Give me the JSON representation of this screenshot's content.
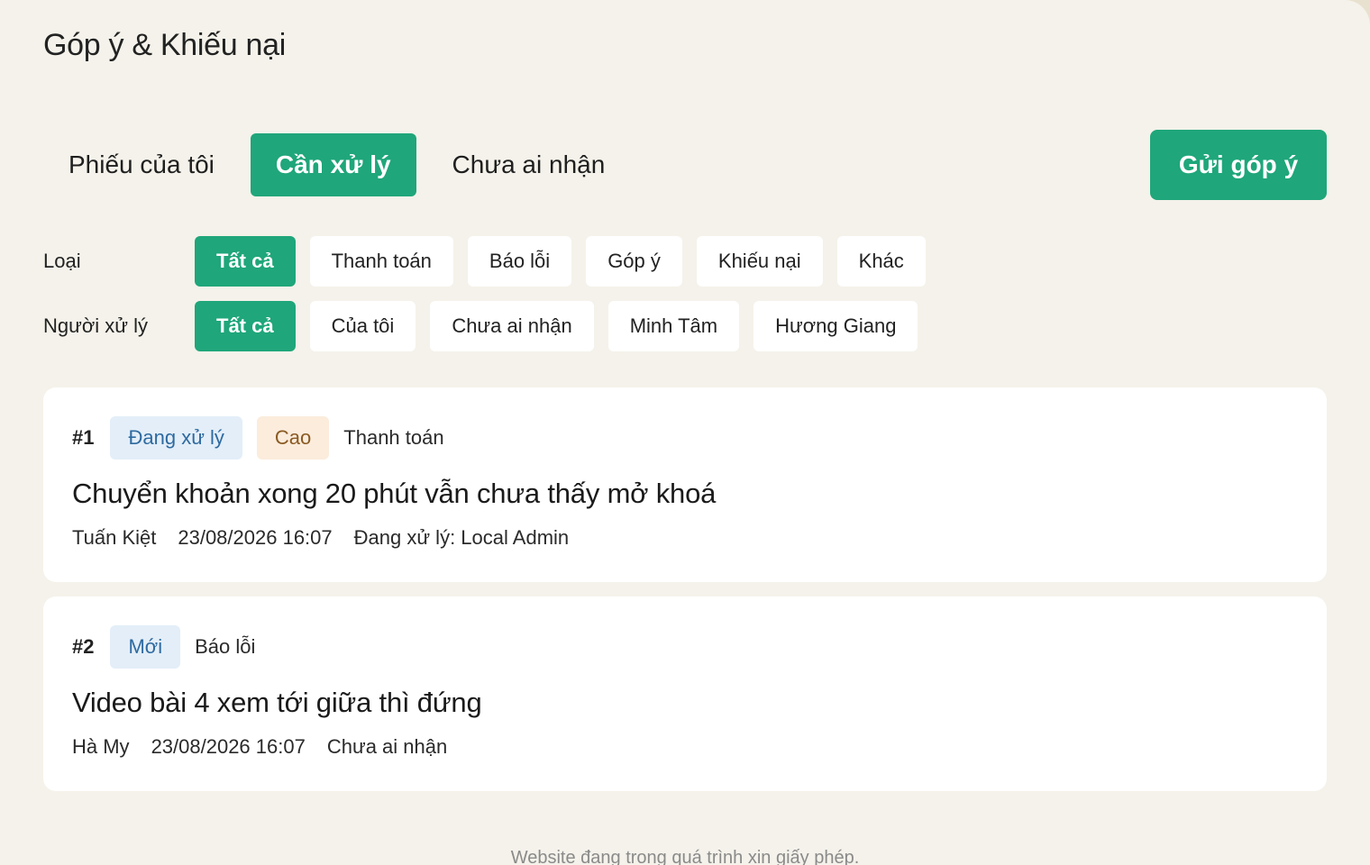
{
  "page": {
    "title": "Góp ý & Khiếu nại",
    "footer_note": "Website đang trong quá trình xin giấy phép."
  },
  "main_tabs": [
    {
      "label": "Phiếu của tôi",
      "active": false
    },
    {
      "label": "Cần xử lý",
      "active": true
    },
    {
      "label": "Chưa ai nhận",
      "active": false
    }
  ],
  "actions": {
    "submit_label": "Gửi góp ý"
  },
  "filters": {
    "type": {
      "label": "Loại",
      "options": [
        {
          "label": "Tất cả",
          "active": true
        },
        {
          "label": "Thanh toán",
          "active": false
        },
        {
          "label": "Báo lỗi",
          "active": false
        },
        {
          "label": "Góp ý",
          "active": false
        },
        {
          "label": "Khiếu nại",
          "active": false
        },
        {
          "label": "Khác",
          "active": false
        }
      ]
    },
    "handler": {
      "label": "Người xử lý",
      "options": [
        {
          "label": "Tất cả",
          "active": true
        },
        {
          "label": "Của tôi",
          "active": false
        },
        {
          "label": "Chưa ai nhận",
          "active": false
        },
        {
          "label": "Minh Tâm",
          "active": false
        },
        {
          "label": "Hương Giang",
          "active": false
        }
      ]
    }
  },
  "tickets": [
    {
      "id": "#1",
      "status": "Đang xử lý",
      "priority": "Cao",
      "category": "Thanh toán",
      "title": "Chuyển khoản xong 20 phút vẫn chưa thấy mở khoá",
      "author": "Tuấn Kiệt",
      "datetime": "23/08/2026 16:07",
      "assignee": "Đang xử lý: Local Admin"
    },
    {
      "id": "#2",
      "status": "Mới",
      "category": "Báo lỗi",
      "title": "Video bài 4 xem tới giữa thì đứng",
      "author": "Hà My",
      "datetime": "23/08/2026 16:07",
      "assignee": "Chưa ai nhận"
    }
  ],
  "colors": {
    "accent": "#1fa67a",
    "status_badge_bg": "#e3eef8",
    "status_badge_text": "#2e6aa0",
    "priority_badge_bg": "#fbecdc",
    "priority_badge_text": "#8a5a22",
    "page_bg": "#f4f2ea"
  }
}
